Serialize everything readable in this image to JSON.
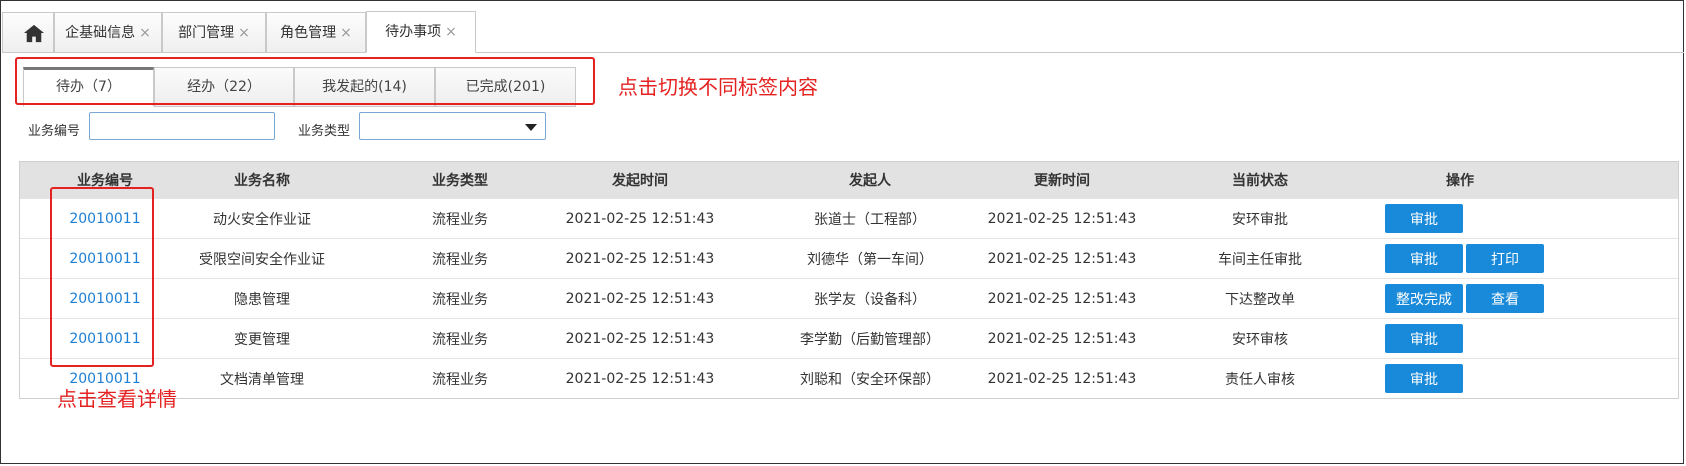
{
  "top_tabs": [
    {
      "label": "企基础信息",
      "close": "×"
    },
    {
      "label": "部门管理",
      "close": "×"
    },
    {
      "label": "角色管理",
      "close": "×"
    },
    {
      "label": "待办事项",
      "close": "×"
    }
  ],
  "sub_tabs": [
    "待办（7）",
    "经办（22）",
    "我发起的(14)",
    "已完成(201)"
  ],
  "annotations": {
    "tabs_note": "点击切换不同标签内容",
    "detail_note": "点击查看详情"
  },
  "filters": {
    "biz_no_label": "业务编号",
    "biz_no_value": "",
    "biz_type_label": "业务类型",
    "biz_type_value": ""
  },
  "table": {
    "headers": [
      "业务编号",
      "业务名称",
      "业务类型",
      "发起时间",
      "发起人",
      "更新时间",
      "当前状态",
      "操作"
    ],
    "rows": [
      {
        "no": "20010011",
        "name": "动火安全作业证",
        "type": "流程业务",
        "start": "2021-02-25  12:51:43",
        "initiator": "张道士（工程部）",
        "update": "2021-02-25  12:51:43",
        "status": "安环审批",
        "actions": [
          "审批"
        ]
      },
      {
        "no": "20010011",
        "name": "受限空间安全作业证",
        "type": "流程业务",
        "start": "2021-02-25  12:51:43",
        "initiator": "刘德华（第一车间）",
        "update": "2021-02-25  12:51:43",
        "status": "车间主任审批",
        "actions": [
          "审批",
          "打印"
        ]
      },
      {
        "no": "20010011",
        "name": "隐患管理",
        "type": "流程业务",
        "start": "2021-02-25  12:51:43",
        "initiator": "张学友（设备科）",
        "update": "2021-02-25  12:51:43",
        "status": "下达整改单",
        "actions": [
          "整改完成",
          "查看"
        ]
      },
      {
        "no": "20010011",
        "name": "变更管理",
        "type": "流程业务",
        "start": "2021-02-25  12:51:43",
        "initiator": "李学勤（后勤管理部）",
        "update": "2021-02-25  12:51:43",
        "status": "安环审核",
        "actions": [
          "审批"
        ]
      },
      {
        "no": "20010011",
        "name": "文档清单管理",
        "type": "流程业务",
        "start": "2021-02-25  12:51:43",
        "initiator": "刘聪和（安全环保部）",
        "update": "2021-02-25  12:51:43",
        "status": "责任人审核",
        "actions": [
          "审批"
        ]
      }
    ]
  },
  "colors": {
    "accent": "#1989d9",
    "link": "#1e7fd4",
    "annotation": "#e52222",
    "header_bg": "#e2e2e2"
  },
  "icons": {
    "home": "home-icon",
    "dropdown": "chevron-down-icon",
    "close": "close-icon"
  }
}
